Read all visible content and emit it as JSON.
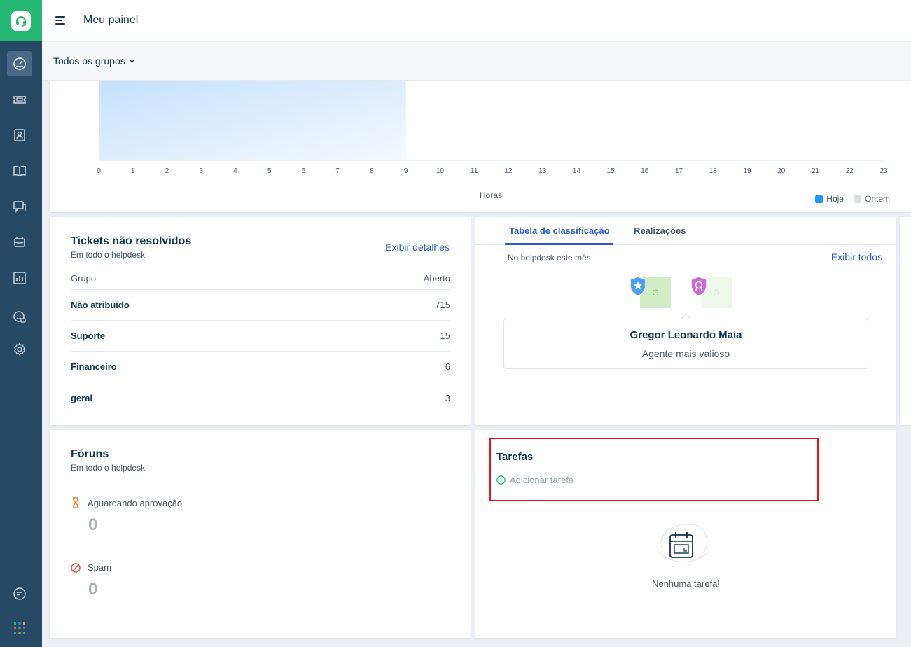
{
  "header": {
    "title": "Meu painel"
  },
  "filter": {
    "group_label": "Todos os grupos"
  },
  "sidebar": {
    "items": [
      {
        "icon": "dashboard-icon",
        "active": true
      },
      {
        "icon": "ticket-icon"
      },
      {
        "icon": "contacts-icon"
      },
      {
        "icon": "book-icon"
      },
      {
        "icon": "forum-icon"
      },
      {
        "icon": "bot-icon"
      },
      {
        "icon": "reports-icon"
      },
      {
        "icon": "smile-chat-icon"
      },
      {
        "icon": "gear-icon"
      }
    ]
  },
  "chart_data": {
    "type": "area",
    "xlabel": "Horas",
    "x": [
      0,
      1,
      2,
      3,
      4,
      5,
      6,
      7,
      8,
      9,
      10,
      11,
      12,
      13,
      14,
      15,
      16,
      17,
      18,
      19,
      20,
      21,
      22,
      23
    ],
    "series": [
      {
        "name": "Hoje",
        "color": "#2196f3"
      },
      {
        "name": "Ontem",
        "color": "#dbdfe3"
      }
    ]
  },
  "tickets": {
    "title": "Tickets não resolvidos",
    "subtitle": "Em todo o helpdesk",
    "link": "Exibir detalhes",
    "col_group": "Grupo",
    "col_open": "Aberto",
    "rows": [
      {
        "group": "Não atribuído",
        "open": "715"
      },
      {
        "group": "Suporte",
        "open": "15"
      },
      {
        "group": "Financeiro",
        "open": "6"
      },
      {
        "group": "geral",
        "open": "3"
      }
    ]
  },
  "leaderboard": {
    "tab1": "Tabela de classificação",
    "tab2": "Realizações",
    "caption": "No helpdesk este mês",
    "link": "Exibir todos",
    "avatar1_initial": "G",
    "avatar2_initial": "G",
    "agent_name": "Gregor Leonardo Maia",
    "agent_role": "Agente mais valioso"
  },
  "forums": {
    "title": "Fóruns",
    "subtitle": "Em todo o helpdesk",
    "pending_label": "Aguardando aprovação",
    "pending_count": "0",
    "spam_label": "Spam",
    "spam_count": "0"
  },
  "tasks": {
    "title": "Tarefas",
    "add_placeholder": "Adicionar tarefa",
    "empty_text": "Nenhuma tarefa!"
  }
}
